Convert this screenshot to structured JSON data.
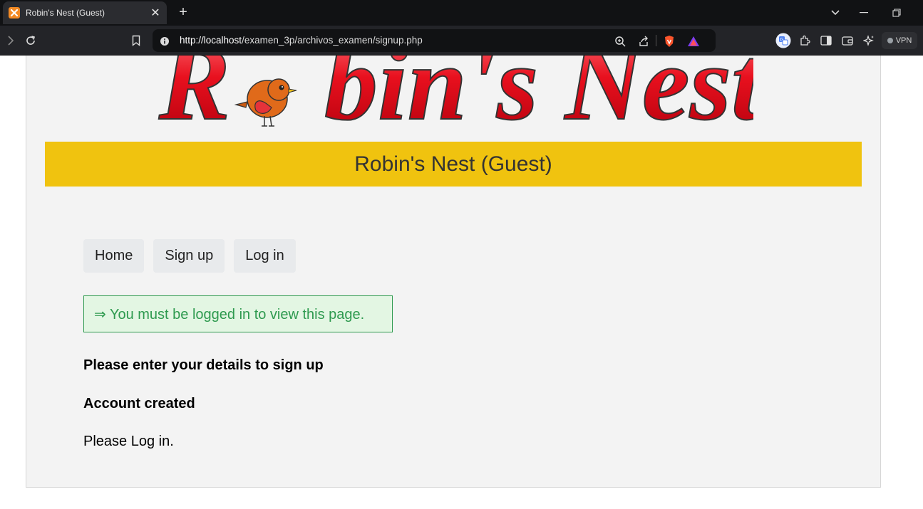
{
  "browser": {
    "tab_title": "Robin's Nest (Guest)",
    "tab_favicon_glyph": "⌬",
    "url_host": "http://localhost",
    "url_path": "/examen_3p/archivos_examen/signup.php",
    "vpn_label": "VPN"
  },
  "site": {
    "logo_text_left": "R",
    "logo_text_right": "bin's Nest",
    "banner_title": "Robin's Nest (Guest)"
  },
  "nav": {
    "items": [
      {
        "label": "Home"
      },
      {
        "label": "Sign up"
      },
      {
        "label": "Log in"
      }
    ]
  },
  "notice": {
    "text": "⇒ You must be logged in to view this page."
  },
  "content": {
    "heading_signup": "Please enter your details to sign up",
    "heading_created": "Account created",
    "message": "Please Log in."
  },
  "colors": {
    "banner": "#f0c30f",
    "notice_text": "#2e9a4f",
    "notice_bg": "#e3f6e3",
    "logo_red": "#e8101e"
  }
}
